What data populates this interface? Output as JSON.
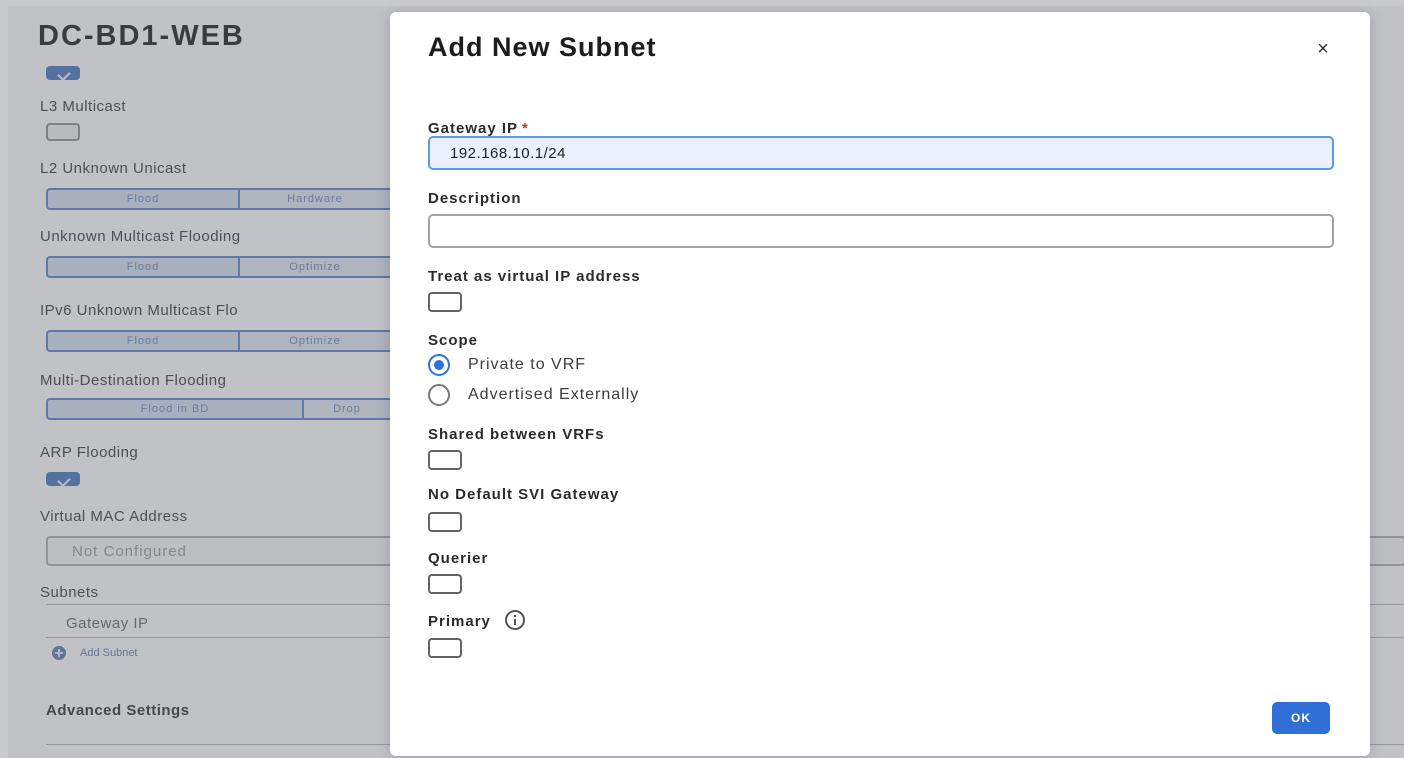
{
  "background": {
    "title": "DC-BD1-WEB",
    "l3_multicast_label": "L3 Multicast",
    "l2_unknown_unicast_label": "L2 Unknown Unicast",
    "l2_unknown_unicast_options": [
      "Flood",
      "Hardware"
    ],
    "unknown_multicast_flooding_label": "Unknown Multicast Flooding",
    "unknown_multicast_flooding_options": [
      "Flood",
      "Optimize"
    ],
    "ipv6_unknown_multicast_label": "IPv6 Unknown Multicast Flo",
    "ipv6_unknown_multicast_options": [
      "Flood",
      "Optimize"
    ],
    "multi_destination_flooding_label": "Multi-Destination Flooding",
    "multi_destination_flooding_options": [
      "Flood in BD",
      "Drop"
    ],
    "arp_flooding_label": "ARP Flooding",
    "virtual_mac_label": "Virtual MAC Address",
    "virtual_mac_placeholder": "Not Configured",
    "subnets_label": "Subnets",
    "subnets_column_gateway": "Gateway IP",
    "add_subnet_label": "Add Subnet",
    "advanced_settings_label": "Advanced Settings"
  },
  "modal": {
    "title": "Add New Subnet",
    "close_symbol": "×",
    "gateway_ip_label": "Gateway IP",
    "required_mark": "*",
    "gateway_ip_value": "192.168.10.1/24",
    "description_label": "Description",
    "description_value": "",
    "treat_virtual_label": "Treat as virtual IP address",
    "scope_label": "Scope",
    "scope_options": [
      "Private to VRF",
      "Advertised Externally"
    ],
    "scope_selected": "Private to VRF",
    "shared_vrfs_label": "Shared between VRFs",
    "no_default_svi_label": "No Default SVI Gateway",
    "querier_label": "Querier",
    "primary_label": "Primary",
    "ok_label": "OK"
  },
  "colors": {
    "accent": "#2f6fd6",
    "required": "#d0301f",
    "focus_border": "#5b9ae6"
  }
}
